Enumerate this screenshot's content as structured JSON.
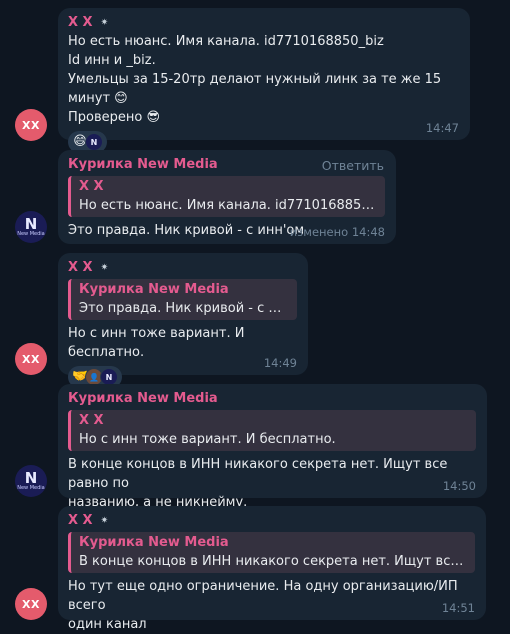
{
  "messages": [
    {
      "sender": "X X",
      "lines": [
        "Но есть нюанс. Имя канала. id7710168850_biz",
        "Id инн и _biz.",
        "Умельцы за 15-20тр делают нужный линк за те же 15 минут 😊",
        "Проверено 😎"
      ],
      "reactions": [
        "😄",
        "N"
      ],
      "time": "14:47",
      "avatar": "XX"
    },
    {
      "sender": "Курилка New Media",
      "reply_action": "Ответить",
      "quote": {
        "sender": "X X",
        "text": "Но есть нюанс. Имя канала. id7710168850_biz I..."
      },
      "text": "Это правда. Ник кривой - с инн'ом",
      "time": "изменено 14:48",
      "avatar": "N",
      "avatar_caption": "New Media"
    },
    {
      "sender": "X X",
      "quote": {
        "sender": "Курилка New Media",
        "text": "Это правда. Ник кривой - с инн'ом"
      },
      "text": "Но с инн тоже вариант. И бесплатно.",
      "reactions": [
        "🤝",
        "👤",
        "N"
      ],
      "time": "14:49",
      "avatar": "XX"
    },
    {
      "sender": "Курилка New Media",
      "quote": {
        "sender": "X X",
        "text": "Но с инн тоже вариант. И бесплатно."
      },
      "lines": [
        "В конце концов в ИНН никакого секрета нет. Ищут все равно по",
        "названию, а не никнейму."
      ],
      "time": "14:50",
      "avatar": "N",
      "avatar_caption": "New Media"
    },
    {
      "sender": "X X",
      "quote": {
        "sender": "Курилка New Media",
        "text": "В конце концов в ИНН никакого секрета нет. Ищут все равн..."
      },
      "lines": [
        "Но тут еще одно ограничение. На одну организацию/ИП всего",
        "один канал"
      ],
      "time": "14:51",
      "avatar": "XX"
    }
  ],
  "colors": {
    "background": "#0e1621",
    "bubble": "#182533",
    "sender_accent": "#e45b8f",
    "quote_bg": "#34313f",
    "avatar_xx": "#e45b6c",
    "avatar_nm": "#1a1c55",
    "meta": "#6f8396"
  },
  "icons": {
    "sender_badge": "sparkle-icon"
  }
}
